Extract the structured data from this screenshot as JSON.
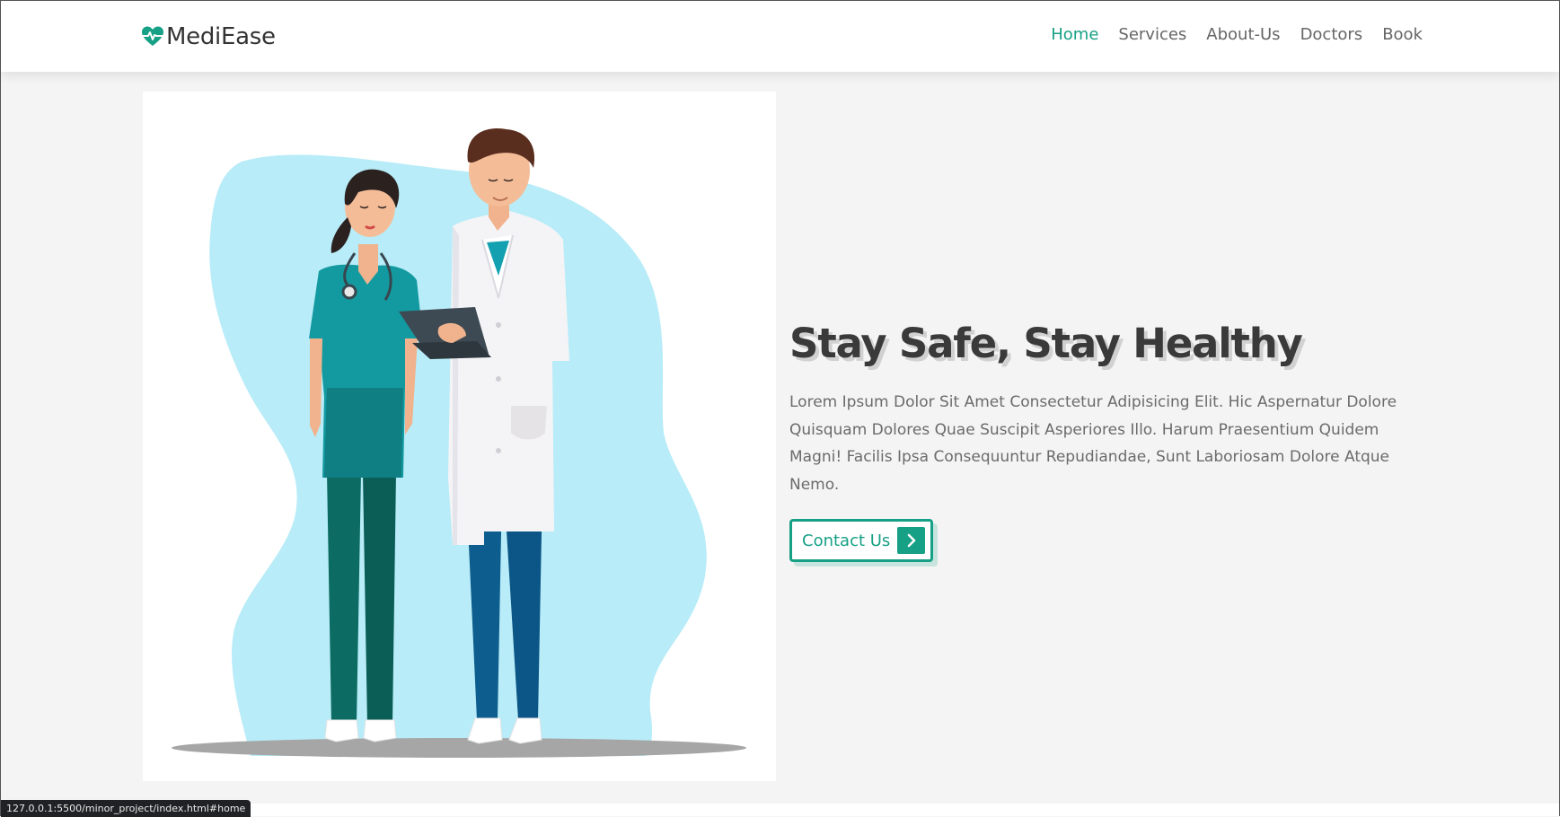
{
  "brand": {
    "name": "MediEase",
    "icon": "heart-pulse-icon",
    "color": "#16a085"
  },
  "nav": {
    "items": [
      "Home",
      "Services",
      "About-Us",
      "Doctors",
      "Book"
    ],
    "active": "Home"
  },
  "hero": {
    "title": "Stay Safe, Stay Healthy",
    "description": "Lorem Ipsum Dolor Sit Amet Consectetur Adipisicing Elit. Hic Aspernatur Dolore Quisquam Dolores Quae Suscipit Asperiores Illo. Harum Praesentium Quidem Magni! Facilis Ipsa Consequuntur Repudiandae, Sunt Laboriosam Dolore Atque Nemo.",
    "cta": {
      "label": "Contact Us",
      "icon": "chevron-right-icon"
    },
    "illustration": "doctors-illustration"
  },
  "status_bar": {
    "url": "127.0.0.1:5500/minor_project/index.html#home"
  },
  "colors": {
    "accent": "#16a085",
    "background": "#f4f4f4",
    "heading": "#3a3a3a",
    "text": "#6b6b6b"
  }
}
